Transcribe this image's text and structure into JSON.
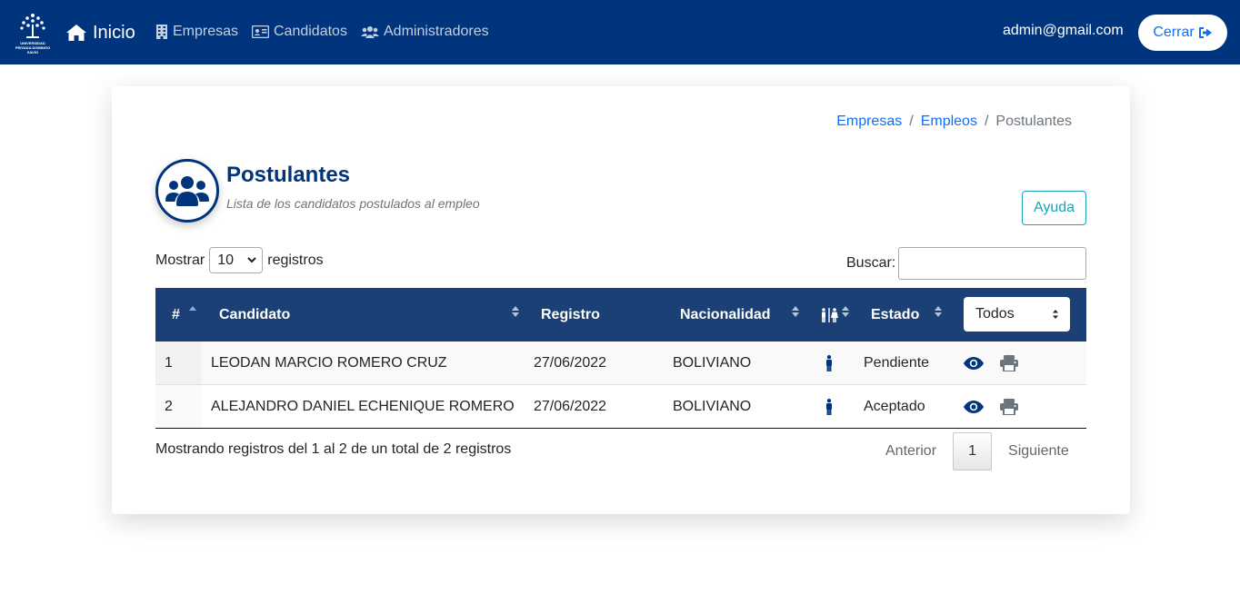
{
  "navbar": {
    "logo_text": "UNIVERSIDAD PRIVADA DOMINGO SAVIO",
    "home_label": "Inicio",
    "links": [
      {
        "label": "Empresas",
        "icon": "building-icon"
      },
      {
        "label": "Candidatos",
        "icon": "id-card-icon"
      },
      {
        "label": "Administradores",
        "icon": "users-cog-icon"
      }
    ],
    "user_email": "admin@gmail.com",
    "logout_label": "Cerrar",
    "colors": {
      "bar": "#00357e",
      "link": "#c4cfe0"
    }
  },
  "breadcrumb": [
    {
      "label": "Empresas",
      "active": false
    },
    {
      "label": "Empleos",
      "active": false
    },
    {
      "label": "Postulantes",
      "active": true
    }
  ],
  "header": {
    "icon": "users-icon",
    "title": "Postulantes",
    "subtitle": "Lista de los candidatos postulados al empleo"
  },
  "help_button": "Ayuda",
  "length_menu": {
    "prefix": "Mostrar",
    "value": "10",
    "suffix": "registros"
  },
  "search": {
    "label": "Buscar:",
    "value": ""
  },
  "table": {
    "columns": [
      "#",
      "Candidato",
      "Registro",
      "Nacionalidad",
      "",
      "Estado"
    ],
    "estado_filter": "Todos",
    "rows": [
      {
        "num": "1",
        "candidato": "LEODAN MARCIO ROMERO CRUZ",
        "registro": "27/06/2022",
        "nacionalidad": "BOLIVIANO",
        "genero_icon": "male-icon",
        "estado": "Pendiente"
      },
      {
        "num": "2",
        "candidato": "ALEJANDRO DANIEL ECHENIQUE ROMERO",
        "registro": "27/06/2022",
        "nacionalidad": "BOLIVIANO",
        "genero_icon": "male-icon",
        "estado": "Aceptado"
      }
    ],
    "header_color": "#1b4076"
  },
  "footer": {
    "info": "Mostrando registros del 1 al 2 de un total de 2 registros",
    "prev": "Anterior",
    "page": "1",
    "next": "Siguiente"
  }
}
